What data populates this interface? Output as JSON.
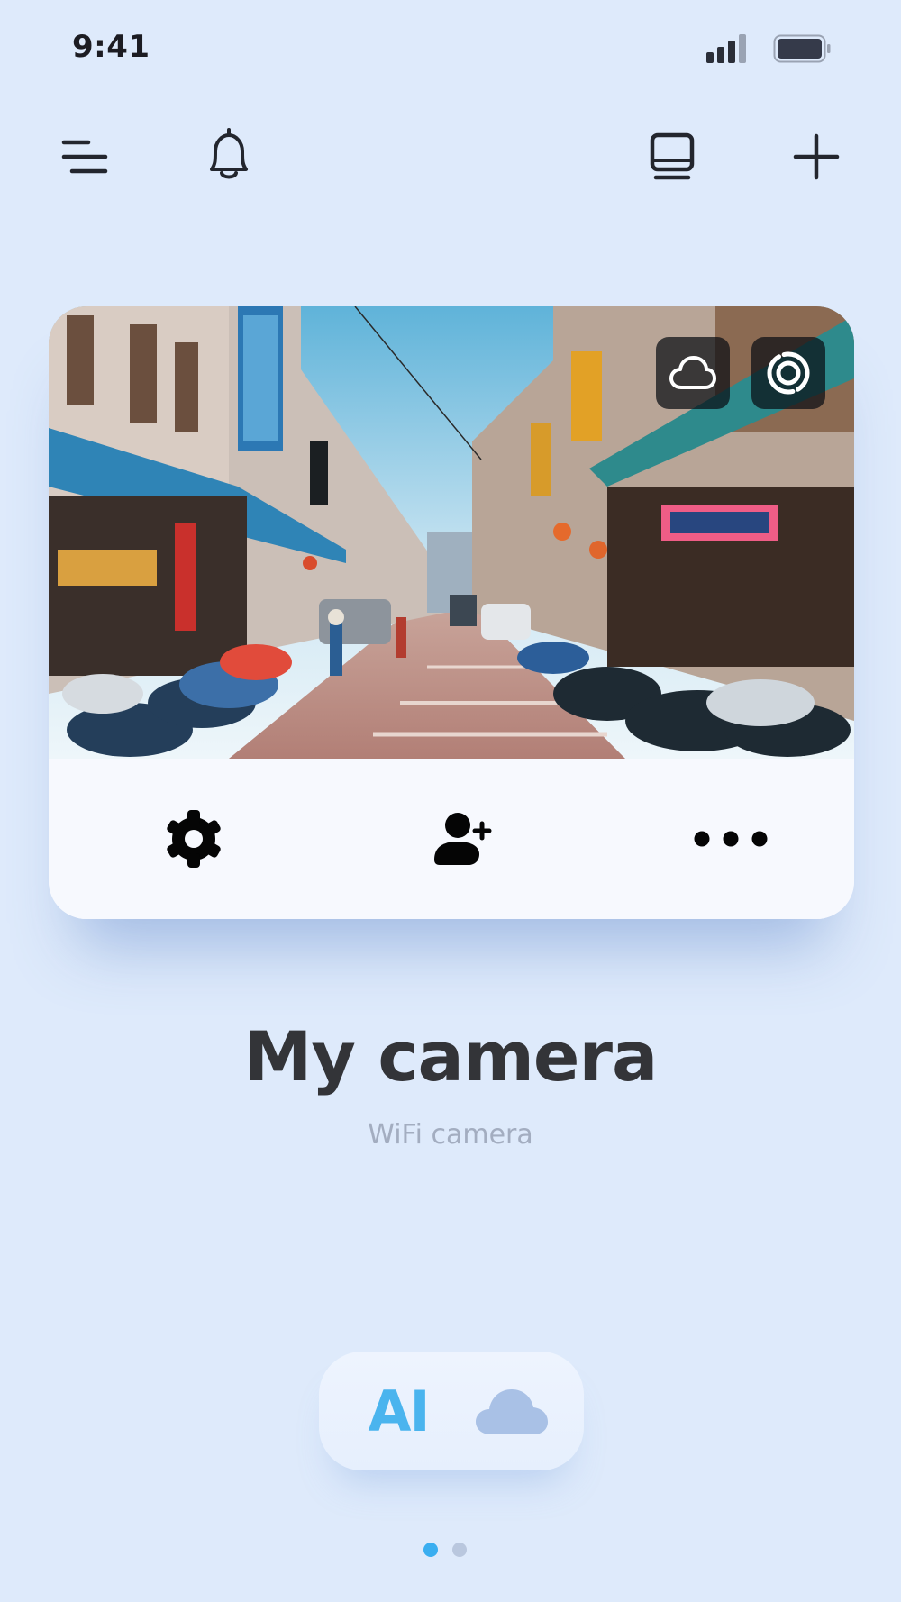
{
  "status_bar": {
    "time": "9:41"
  },
  "toolbar": {
    "menu_icon": "menu-lines-icon",
    "notifications_icon": "bell-icon",
    "device_icon": "monitor-icon",
    "add_icon": "plus-icon"
  },
  "camera_card": {
    "preview_alt": "Street scene camera feed",
    "overlay_buttons": [
      "cloud-icon",
      "capture-target-icon"
    ],
    "actions": [
      "gear-icon",
      "add-user-icon",
      "more-dots-icon"
    ]
  },
  "device": {
    "name": "My camera",
    "type": "WiFi camera"
  },
  "features": {
    "ai_label": "AI",
    "cloud_icon": "cloud-icon"
  },
  "pagination": {
    "total": 2,
    "active": 1
  },
  "colors": {
    "background": "#deeafb",
    "accent": "#3aaef0",
    "title": "#333438",
    "subtitle": "#a3adc0"
  }
}
